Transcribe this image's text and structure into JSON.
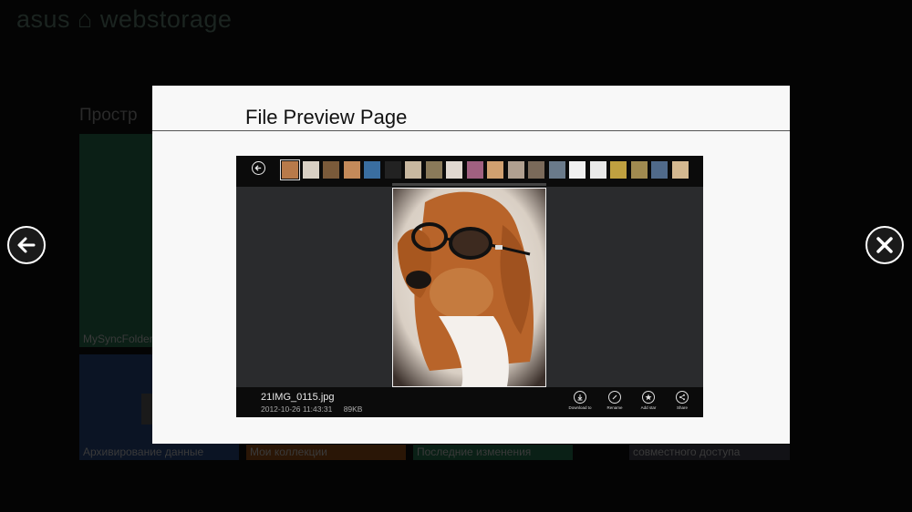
{
  "app": {
    "brand": "asus ⌂ webstorage",
    "section_title": "Простр"
  },
  "background_tiles": [
    {
      "label": "MySyncFolder"
    },
    {
      "label": "Архивирование данные"
    },
    {
      "label": "Мои коллекции"
    },
    {
      "label": "Последние изменения"
    },
    {
      "label": "совместного доступа"
    }
  ],
  "dialog": {
    "title": "File Preview Page"
  },
  "preview": {
    "file_name": "21IMG_0115.jpg",
    "date": "2012-10-26 11:43:31",
    "size": "89KB",
    "thumbnail_count": 20,
    "selected_thumbnail": 0,
    "actions": [
      {
        "label": "Download to",
        "icon": "download-icon"
      },
      {
        "label": "Rename",
        "icon": "pencil-icon"
      },
      {
        "label": "Add star",
        "icon": "star-icon"
      },
      {
        "label": "Share",
        "icon": "share-icon"
      }
    ]
  },
  "nav": {
    "prev_icon": "arrow-left-icon",
    "close_icon": "close-icon"
  }
}
